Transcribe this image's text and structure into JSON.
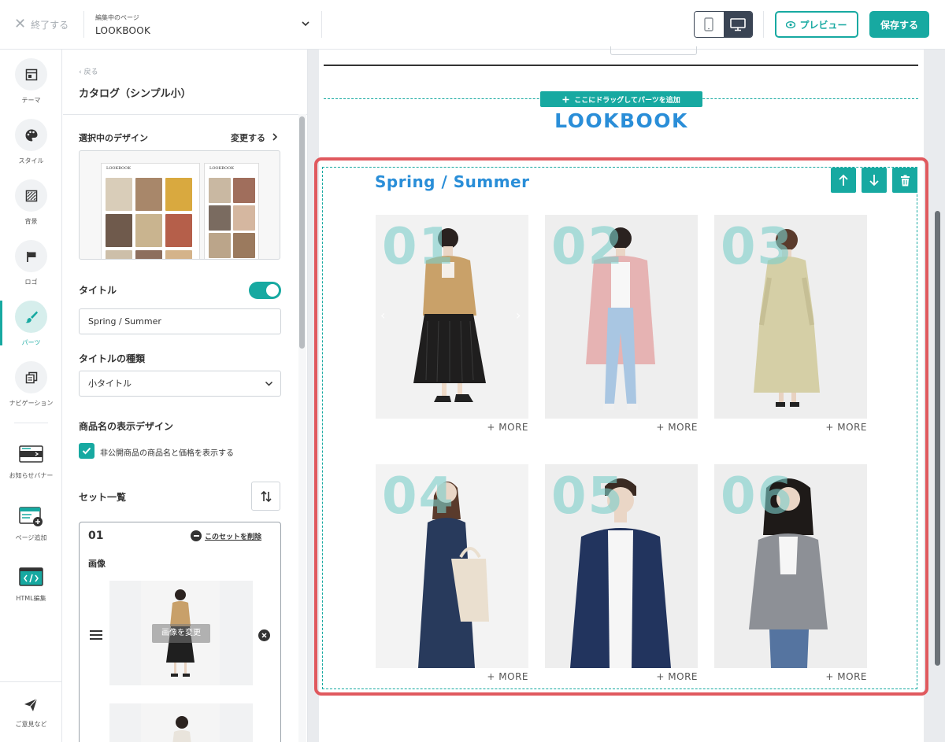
{
  "topbar": {
    "close_label": "終了する",
    "editing_label": "編集中のページ",
    "page_name": "LOOKBOOK",
    "preview_label": "プレビュー",
    "save_label": "保存する"
  },
  "rail": {
    "items": [
      {
        "label": "テーマ"
      },
      {
        "label": "スタイル"
      },
      {
        "label": "背景"
      },
      {
        "label": "ロゴ"
      },
      {
        "label": "パーツ"
      },
      {
        "label": "ナビゲーション"
      }
    ],
    "extras": [
      {
        "label": "お知らせバナー"
      },
      {
        "label": "ページ追加"
      },
      {
        "label": "HTML編集"
      }
    ],
    "feedback_label": "ご意見など"
  },
  "panel": {
    "back_label": "戻る",
    "title": "カタログ（シンプル小）",
    "design_label": "選択中のデザイン",
    "change_label": "変更する",
    "thumb_title": "LOOKBOOK",
    "title_label": "タイトル",
    "title_value": "Spring / Summer",
    "title_type_label": "タイトルの種類",
    "title_type_value": "小タイトル",
    "product_name_label": "商品名の表示デザイン",
    "checkbox_label": "非公開商品の商品名と価格を表示する",
    "set_list_label": "セット一覧",
    "set": {
      "number": "01",
      "delete_label": "このセットを削除",
      "image_label": "画像",
      "change_image_label": "画像を変更"
    }
  },
  "canvas": {
    "add_parts_label": "ここにドラッグしてパーツを追加",
    "page_title": "LOOKBOOK",
    "section_title": "Spring / Summer",
    "more_label": "+ MORE",
    "items": [
      {
        "num": "01"
      },
      {
        "num": "02"
      },
      {
        "num": "03"
      },
      {
        "num": "04"
      },
      {
        "num": "05"
      },
      {
        "num": "06"
      }
    ]
  },
  "colors": {
    "accent": "#17a9a1",
    "title_blue": "#2a8ed8",
    "selection_red": "#e0595e",
    "dark": "#3a4454"
  }
}
